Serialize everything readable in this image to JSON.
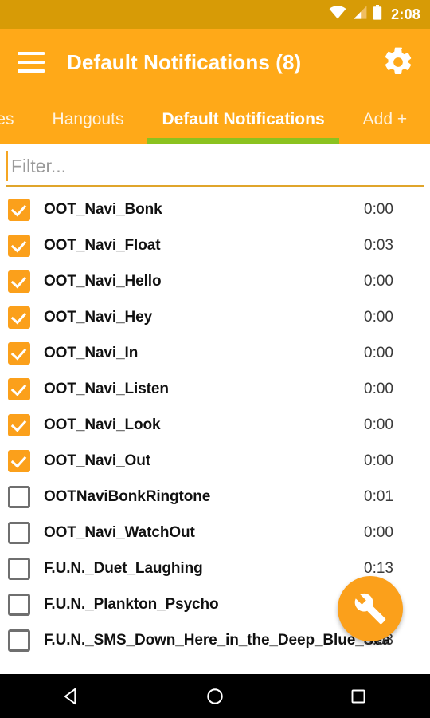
{
  "status_bar": {
    "time": "2:08",
    "icons": [
      "wifi-icon",
      "cell-signal-icon",
      "battery-icon"
    ],
    "background": "#D79B06"
  },
  "app_bar": {
    "menu_icon": "hamburger-menu-icon",
    "title": "Default Notifications (8)",
    "settings_icon": "gear-icon",
    "background": "#FFA918"
  },
  "tabs": {
    "indicator_color": "#8BC220",
    "items": [
      {
        "label": "ones",
        "active": false
      },
      {
        "label": "Hangouts",
        "active": false
      },
      {
        "label": "Default Notifications",
        "active": true
      },
      {
        "label": "Add +",
        "active": false
      }
    ]
  },
  "filter": {
    "value": "",
    "placeholder": "Filter...",
    "underline_color": "#E0A52B",
    "caret_color": "#F5A623"
  },
  "list": {
    "checked_color": "#FBA01B",
    "rows": [
      {
        "label": "OOT_Navi_Bonk",
        "duration": "0:00",
        "checked": true
      },
      {
        "label": "OOT_Navi_Float",
        "duration": "0:03",
        "checked": true
      },
      {
        "label": "OOT_Navi_Hello",
        "duration": "0:00",
        "checked": true
      },
      {
        "label": "OOT_Navi_Hey",
        "duration": "0:00",
        "checked": true
      },
      {
        "label": "OOT_Navi_In",
        "duration": "0:00",
        "checked": true
      },
      {
        "label": "OOT_Navi_Listen",
        "duration": "0:00",
        "checked": true
      },
      {
        "label": "OOT_Navi_Look",
        "duration": "0:00",
        "checked": true
      },
      {
        "label": "OOT_Navi_Out",
        "duration": "0:00",
        "checked": true
      },
      {
        "label": "OOTNaviBonkRingtone",
        "duration": "0:01",
        "checked": false
      },
      {
        "label": "OOT_Navi_WatchOut",
        "duration": "0:00",
        "checked": false
      },
      {
        "label": "F.U.N._Duet_Laughing",
        "duration": "0:13",
        "checked": false
      },
      {
        "label": "F.U.N._Plankton_Psycho",
        "duration": "",
        "checked": false
      },
      {
        "label": "F.U.N._SMS_Down_Here_in_the_Deep_Blue_Sea",
        "duration": "0:03",
        "checked": false
      }
    ]
  },
  "fab": {
    "icon": "wrench-icon",
    "color": "#FBA01B"
  },
  "nav_bar": {
    "back": "back-triangle-icon",
    "home": "home-circle-icon",
    "recents": "recents-square-icon"
  }
}
